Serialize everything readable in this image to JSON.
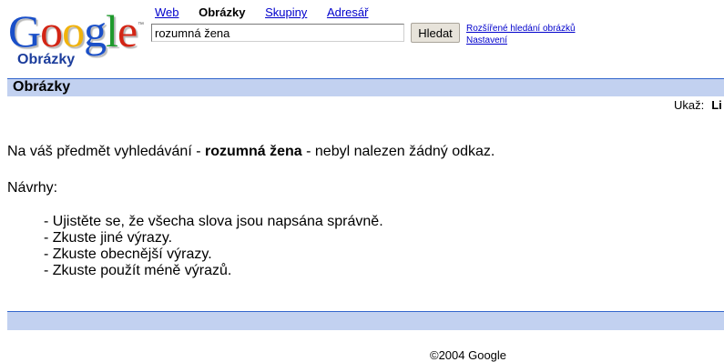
{
  "logo": {
    "letters": [
      "G",
      "o",
      "o",
      "g",
      "l",
      "e"
    ],
    "trademark": "™",
    "subtitle": "Obrázky",
    "letter_colors": [
      "#1a4fc8",
      "#d32515",
      "#f0b20c",
      "#1a4fc8",
      "#1e9a2c",
      "#d32515"
    ]
  },
  "nav": {
    "tabs": [
      {
        "label": "Web",
        "active": false
      },
      {
        "label": "Obrázky",
        "active": true
      },
      {
        "label": "Skupiny",
        "active": false
      },
      {
        "label": "Adresář",
        "active": false
      }
    ]
  },
  "search": {
    "query": "rozumná žena",
    "button_label": "Hledat",
    "advanced_link": "Rozšířené hledání obrázků",
    "settings_link": "Nastavení"
  },
  "results_header": {
    "title": "Obrázky",
    "show_label": "Ukaž:",
    "show_value": "Li"
  },
  "message": {
    "prefix": "Na váš předmět vyhledávání - ",
    "query": "rozumná žena",
    "suffix": " - nebyl nalezen žádný odkaz.",
    "suggestions_label": "Návrhy:",
    "suggestions": [
      "- Ujistěte se, že všecha slova jsou napsána správně.",
      "- Zkuste jiné výrazy.",
      "- Zkuste obecnější výrazy.",
      "- Zkuste použít méně výrazů."
    ]
  },
  "footer": {
    "copyright": "©2004 Google"
  },
  "colors": {
    "bar_background": "#c2d1f0",
    "bar_border": "#3366cc",
    "link": "#0000cc"
  }
}
